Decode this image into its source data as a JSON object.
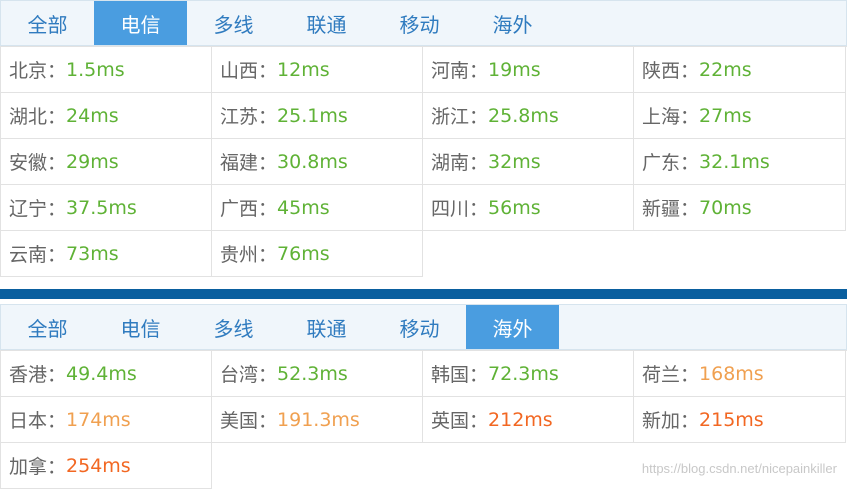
{
  "tabs": [
    "全部",
    "电信",
    "多线",
    "联通",
    "移动",
    "海外"
  ],
  "separator": "：",
  "panel1": {
    "active_tab": "电信",
    "entries": [
      {
        "name": "北京",
        "value": "1.5ms",
        "status": "green"
      },
      {
        "name": "山西",
        "value": "12ms",
        "status": "green"
      },
      {
        "name": "河南",
        "value": "19ms",
        "status": "green"
      },
      {
        "name": "陕西",
        "value": "22ms",
        "status": "green"
      },
      {
        "name": "湖北",
        "value": "24ms",
        "status": "green"
      },
      {
        "name": "江苏",
        "value": "25.1ms",
        "status": "green"
      },
      {
        "name": "浙江",
        "value": "25.8ms",
        "status": "green"
      },
      {
        "name": "上海",
        "value": "27ms",
        "status": "green"
      },
      {
        "name": "安徽",
        "value": "29ms",
        "status": "green"
      },
      {
        "name": "福建",
        "value": "30.8ms",
        "status": "green"
      },
      {
        "name": "湖南",
        "value": "32ms",
        "status": "green"
      },
      {
        "name": "广东",
        "value": "32.1ms",
        "status": "green"
      },
      {
        "name": "辽宁",
        "value": "37.5ms",
        "status": "green"
      },
      {
        "name": "广西",
        "value": "45ms",
        "status": "green"
      },
      {
        "name": "四川",
        "value": "56ms",
        "status": "green"
      },
      {
        "name": "新疆",
        "value": "70ms",
        "status": "green"
      },
      {
        "name": "云南",
        "value": "73ms",
        "status": "green"
      },
      {
        "name": "贵州",
        "value": "76ms",
        "status": "green"
      }
    ]
  },
  "panel2": {
    "active_tab": "海外",
    "entries": [
      {
        "name": "香港",
        "value": "49.4ms",
        "status": "green"
      },
      {
        "name": "台湾",
        "value": "52.3ms",
        "status": "green"
      },
      {
        "name": "韩国",
        "value": "72.3ms",
        "status": "green"
      },
      {
        "name": "荷兰",
        "value": "168ms",
        "status": "orange"
      },
      {
        "name": "日本",
        "value": "174ms",
        "status": "orange"
      },
      {
        "name": "美国",
        "value": "191.3ms",
        "status": "orange"
      },
      {
        "name": "英国",
        "value": "212ms",
        "status": "red"
      },
      {
        "name": "新加",
        "value": "215ms",
        "status": "red"
      },
      {
        "name": "加拿",
        "value": "254ms",
        "status": "red"
      }
    ]
  },
  "colors": {
    "green": "#5fb236",
    "orange": "#f0a050",
    "red": "#f26722",
    "tab_active_bg": "#4a9de0",
    "divider": "#0a5f9f"
  },
  "watermark": "https://blog.csdn.net/nicepainkiller"
}
